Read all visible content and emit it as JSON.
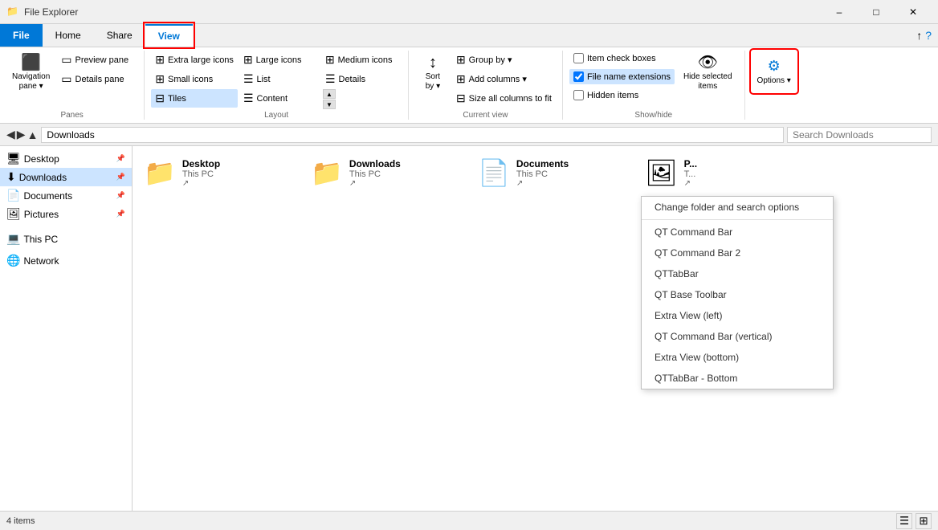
{
  "titleBar": {
    "title": "File Explorer",
    "minimize": "–",
    "maximize": "□",
    "close": "✕"
  },
  "ribbon": {
    "tabs": [
      {
        "id": "file",
        "label": "File",
        "active": false,
        "file": true
      },
      {
        "id": "home",
        "label": "Home",
        "active": false
      },
      {
        "id": "share",
        "label": "Share",
        "active": false
      },
      {
        "id": "view",
        "label": "View",
        "active": true
      }
    ],
    "groups": {
      "panes": {
        "label": "Panes",
        "items": [
          {
            "id": "nav-pane",
            "label": "Navigation\npane",
            "icon": "⬛",
            "dropdown": true
          },
          {
            "id": "preview-pane",
            "label": "Preview pane",
            "icon": "▭"
          },
          {
            "id": "details-pane",
            "label": "Details pane",
            "icon": "▭"
          }
        ]
      },
      "layout": {
        "label": "Layout",
        "items": [
          {
            "id": "extra-large",
            "label": "Extra large icons"
          },
          {
            "id": "large-icons",
            "label": "Large icons"
          },
          {
            "id": "medium-icons",
            "label": "Medium icons"
          },
          {
            "id": "small-icons",
            "label": "Small icons"
          },
          {
            "id": "list",
            "label": "List"
          },
          {
            "id": "details",
            "label": "Details"
          },
          {
            "id": "tiles",
            "label": "Tiles",
            "active": true
          },
          {
            "id": "content",
            "label": "Content"
          }
        ]
      },
      "current-view": {
        "label": "Current view",
        "sort": "Sort\nby",
        "group-by": "Group by",
        "add-columns": "Add columns",
        "size-columns": "Size all columns to fit"
      },
      "show-hide": {
        "label": "Show/hide",
        "item-check-boxes": "Item check boxes",
        "file-name-ext": "File name extensions",
        "hidden-items": "Hidden items",
        "hide-selected": "Hide selected\nitems"
      },
      "options": {
        "label": "Options",
        "button": "Options",
        "icon": "⚙"
      }
    }
  },
  "addressBar": {
    "path": "Downloads",
    "search": "Search Downloads"
  },
  "navPane": {
    "items": [
      {
        "id": "desktop",
        "label": "Desktop",
        "icon": "🖥",
        "pinned": true
      },
      {
        "id": "downloads",
        "label": "Downloads",
        "icon": "⬇",
        "pinned": true,
        "selected": true
      },
      {
        "id": "documents",
        "label": "Documents",
        "icon": "📄",
        "pinned": true
      },
      {
        "id": "pictures",
        "label": "Pictures",
        "icon": "🖼",
        "pinned": true
      },
      {
        "id": "this-pc",
        "label": "This PC",
        "icon": "💻"
      },
      {
        "id": "network",
        "label": "Network",
        "icon": "🌐"
      }
    ]
  },
  "contentArea": {
    "folders": [
      {
        "name": "Desktop",
        "sub": "This PC",
        "arrow": "↗"
      },
      {
        "name": "Downloads",
        "sub": "This PC",
        "arrow": "↗"
      },
      {
        "name": "Documents",
        "sub": "This PC",
        "arrow": "↗"
      },
      {
        "name": "P...",
        "sub": "T...",
        "arrow": "↗"
      }
    ]
  },
  "dropdownMenu": {
    "items": [
      {
        "label": "Change folder and search options"
      },
      {
        "label": "QT Command Bar"
      },
      {
        "label": "QT Command Bar 2"
      },
      {
        "label": "QTTabBar"
      },
      {
        "label": "QT Base Toolbar"
      },
      {
        "label": "Extra View (left)"
      },
      {
        "label": "QT Command Bar (vertical)"
      },
      {
        "label": "Extra View (bottom)"
      },
      {
        "label": "QTTabBar - Bottom"
      }
    ]
  },
  "statusBar": {
    "itemCount": "4 items"
  }
}
